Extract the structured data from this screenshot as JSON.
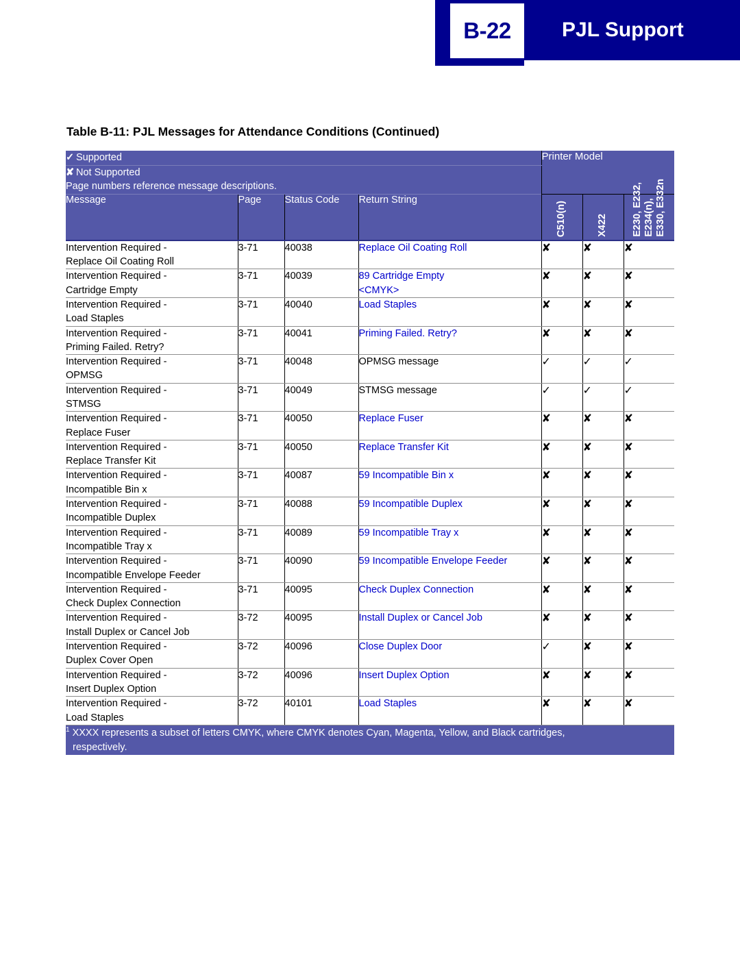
{
  "header": {
    "chapter": "B-22",
    "title": "PJL Support"
  },
  "table": {
    "caption": "Table B-11:  PJL Messages for Attendance Conditions (Continued)",
    "legend": {
      "supported_mark": "✓",
      "supported_label": "Supported",
      "not_supported_mark": "✘",
      "not_supported_label": "Not Supported",
      "note": "Page numbers reference message descriptions."
    },
    "printer_model_header": "Printer Model",
    "columns": {
      "message": "Message",
      "page": "Page",
      "status_code": "Status Code",
      "return_string": "Return String"
    },
    "model_columns": [
      {
        "label": "C510(n)",
        "lines": [
          "C510(n)"
        ]
      },
      {
        "label": "X422",
        "lines": [
          "X422"
        ]
      },
      {
        "label": "E230, E232, E234(n), E330, E332n",
        "lines": [
          "E230, E232,",
          "E234(n),",
          "E330, E332n"
        ]
      }
    ],
    "marks": {
      "supported": "✓",
      "not_supported": "✘"
    },
    "rows": [
      {
        "message_line1": "Intervention Required -",
        "message_line2": "Replace Oil Coating Roll",
        "page": "3-71",
        "status_code": "40038",
        "return_string_line1": "Replace Oil Coating Roll",
        "return_string_line2": "",
        "return_blue": true,
        "support": [
          "✘",
          "✘",
          "✘"
        ]
      },
      {
        "message_line1": "Intervention Required -",
        "message_line2": "Cartridge Empty",
        "page": "3-71",
        "status_code": "40039",
        "return_string_line1": "89 Cartridge Empty",
        "return_string_line2": "<CMYK>",
        "return_blue": true,
        "support": [
          "✘",
          "✘",
          "✘"
        ]
      },
      {
        "message_line1": "Intervention Required -",
        "message_line2": "Load Staples",
        "page": "3-71",
        "status_code": "40040",
        "return_string_line1": "Load Staples",
        "return_string_line2": "",
        "return_blue": true,
        "support": [
          "✘",
          "✘",
          "✘"
        ]
      },
      {
        "message_line1": "Intervention Required -",
        "message_line2": "Priming Failed. Retry?",
        "page": "3-71",
        "status_code": "40041",
        "return_string_line1": "Priming Failed. Retry?",
        "return_string_line2": "",
        "return_blue": true,
        "support": [
          "✘",
          "✘",
          "✘"
        ]
      },
      {
        "message_line1": "Intervention Required -",
        "message_line2": "OPMSG",
        "page": "3-71",
        "status_code": "40048",
        "return_string_line1": "OPMSG message",
        "return_string_line2": "",
        "return_blue": false,
        "support": [
          "✓",
          "✓",
          "✓"
        ]
      },
      {
        "message_line1": "Intervention Required -",
        "message_line2": "STMSG",
        "page": "3-71",
        "status_code": "40049",
        "return_string_line1": "STMSG message",
        "return_string_line2": "",
        "return_blue": false,
        "support": [
          "✓",
          "✓",
          "✓"
        ]
      },
      {
        "message_line1": "Intervention Required -",
        "message_line2": "Replace Fuser",
        "page": "3-71",
        "status_code": "40050",
        "return_string_line1": "Replace Fuser",
        "return_string_line2": "",
        "return_blue": true,
        "support": [
          "✘",
          "✘",
          "✘"
        ]
      },
      {
        "message_line1": "Intervention Required -",
        "message_line2": "Replace Transfer Kit",
        "page": "3-71",
        "status_code": "40050",
        "return_string_line1": "Replace Transfer Kit",
        "return_string_line2": "",
        "return_blue": true,
        "support": [
          "✘",
          "✘",
          "✘"
        ]
      },
      {
        "message_line1": "Intervention Required -",
        "message_line2": "Incompatible Bin x",
        "page": "3-71",
        "status_code": "40087",
        "return_string_line1": "59 Incompatible Bin x",
        "return_string_line2": "",
        "return_blue": true,
        "support": [
          "✘",
          "✘",
          "✘"
        ]
      },
      {
        "message_line1": "Intervention Required -",
        "message_line2": "Incompatible Duplex",
        "page": "3-71",
        "status_code": "40088",
        "return_string_line1": "59 Incompatible Duplex",
        "return_string_line2": "",
        "return_blue": true,
        "support": [
          "✘",
          "✘",
          "✘"
        ]
      },
      {
        "message_line1": "Intervention Required -",
        "message_line2": "Incompatible Tray x",
        "page": "3-71",
        "status_code": "40089",
        "return_string_line1": "59 Incompatible Tray x",
        "return_string_line2": "",
        "return_blue": true,
        "support": [
          "✘",
          "✘",
          "✘"
        ]
      },
      {
        "message_line1": "Intervention Required -",
        "message_line2": "Incompatible Envelope Feeder",
        "page": "3-71",
        "status_code": "40090",
        "return_string_line1": "59 Incompatible Envelope Feeder",
        "return_string_line2": "",
        "return_blue": true,
        "support": [
          "✘",
          "✘",
          "✘"
        ]
      },
      {
        "message_line1": "Intervention Required -",
        "message_line2": "Check Duplex Connection",
        "page": "3-71",
        "status_code": "40095",
        "return_string_line1": "Check Duplex Connection",
        "return_string_line2": "",
        "return_blue": true,
        "support": [
          "✘",
          "✘",
          "✘"
        ]
      },
      {
        "message_line1": "Intervention Required -",
        "message_line2": "Install Duplex or Cancel Job",
        "page": "3-72",
        "status_code": "40095",
        "return_string_line1": "Install Duplex or Cancel Job",
        "return_string_line2": "",
        "return_blue": true,
        "support": [
          "✘",
          "✘",
          "✘"
        ]
      },
      {
        "message_line1": "Intervention Required -",
        "message_line2": "Duplex Cover Open",
        "page": "3-72",
        "status_code": "40096",
        "return_string_line1": "Close Duplex Door",
        "return_string_line2": "",
        "return_blue": true,
        "support": [
          "✓",
          "✘",
          "✘"
        ]
      },
      {
        "message_line1": "Intervention Required -",
        "message_line2": "Insert Duplex Option",
        "page": "3-72",
        "status_code": "40096",
        "return_string_line1": "Insert Duplex Option",
        "return_string_line2": "",
        "return_blue": true,
        "support": [
          "✘",
          "✘",
          "✘"
        ]
      },
      {
        "message_line1": "Intervention Required -",
        "message_line2": "Load Staples",
        "page": "3-72",
        "status_code": "40101",
        "return_string_line1": "Load Staples",
        "return_string_line2": "",
        "return_blue": true,
        "support": [
          "✘",
          "✘",
          "✘"
        ]
      }
    ],
    "footnote": {
      "marker": "1",
      "line1": "XXXX represents a subset of letters CMYK, where CMYK denotes Cyan, Magenta, Yellow, and Black cartridges,",
      "line2": "respectively."
    }
  },
  "colors": {
    "navy": "#00008f",
    "table_header_purple": "#5458a8",
    "return_string_blue": "#0000cc"
  }
}
